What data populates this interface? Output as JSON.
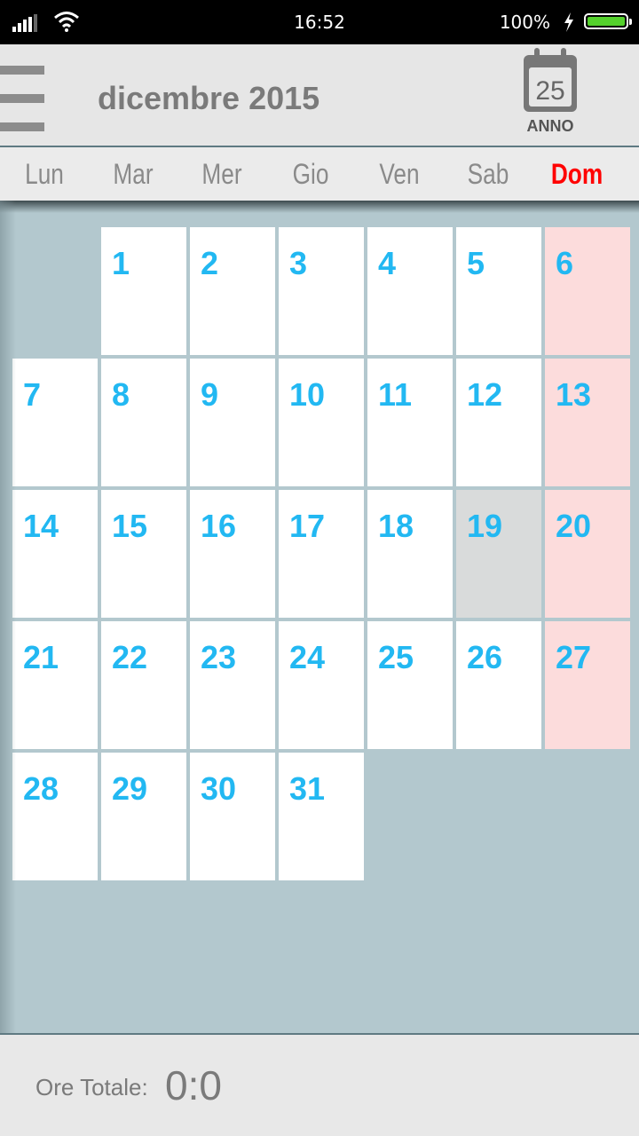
{
  "status_bar": {
    "time": "16:52",
    "battery_percent": "100%",
    "battery_level": 1.0,
    "icons": [
      "signal-icon",
      "wifi-icon",
      "charging-bolt-icon",
      "battery-icon"
    ]
  },
  "header": {
    "menu_icon": "hamburger-menu-icon",
    "title": "dicembre 2015",
    "year_button": {
      "icon": "calendar-icon",
      "icon_number": "25",
      "label": "ANNO"
    }
  },
  "weekdays": [
    "Lun",
    "Mar",
    "Mer",
    "Gio",
    "Ven",
    "Sab",
    "Dom"
  ],
  "colors": {
    "day_number": "#22b8f2",
    "sunday_header": "#ff0000",
    "sunday_cell": "#fcdcdc",
    "today_cell": "#d9dbdb",
    "background": "#b3c8ce"
  },
  "calendar": {
    "first_weekday_offset": 1,
    "days_in_month": 31,
    "highlighted_day": 19,
    "days": [
      "1",
      "2",
      "3",
      "4",
      "5",
      "6",
      "7",
      "8",
      "9",
      "10",
      "11",
      "12",
      "13",
      "14",
      "15",
      "16",
      "17",
      "18",
      "19",
      "20",
      "21",
      "22",
      "23",
      "24",
      "25",
      "26",
      "27",
      "28",
      "29",
      "30",
      "31"
    ]
  },
  "footer": {
    "label": "Ore Totale:",
    "value": "0:0"
  }
}
